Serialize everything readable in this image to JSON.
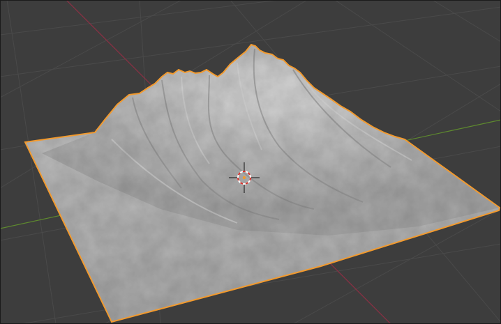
{
  "viewport": {
    "background": "#3d3d3d",
    "grid_color": "#4a4a4a",
    "x_axis_color": "#8c3045",
    "y_axis_color": "#5e8a2e",
    "selection_outline_color": "#f29a2e",
    "mesh_color": "#b3b3b3"
  },
  "scene": {
    "object": "terrain-mesh",
    "object_selected": true,
    "show_grid_floor": true,
    "show_axes": [
      "x",
      "y"
    ],
    "cursor_3d_visible": true,
    "shading": "solid"
  }
}
